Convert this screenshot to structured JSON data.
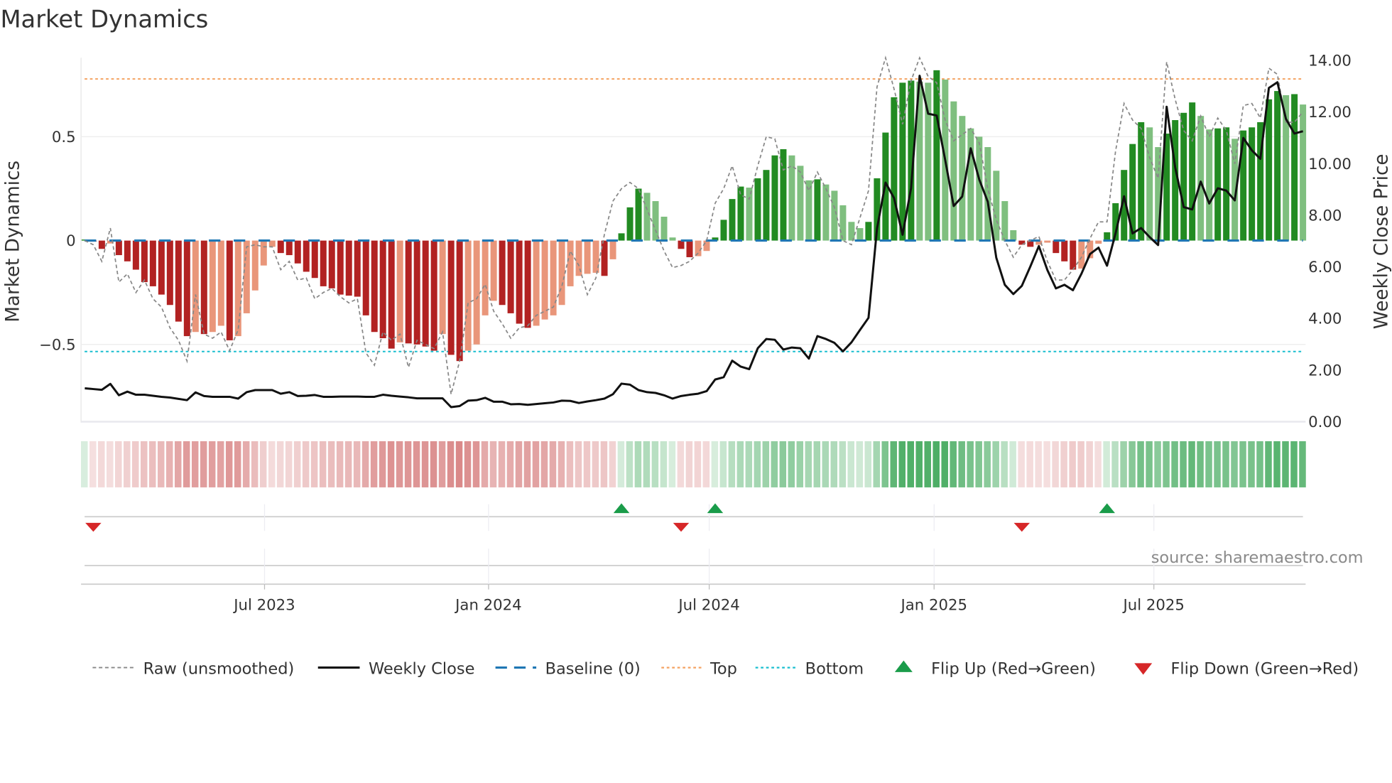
{
  "chart_data": {
    "type": "bar",
    "title": "Market Dynamics",
    "ylabel": "Market Dynamics",
    "y2label": "Weekly Close Price",
    "ylim": [
      -0.87,
      0.89
    ],
    "y2lim": [
      0,
      14.5
    ],
    "yticks": [
      {
        "v": 0.5,
        "label": "0.5"
      },
      {
        "v": 0,
        "label": "0"
      },
      {
        "v": -0.5,
        "label": "−0.5"
      }
    ],
    "y2ticks": [
      {
        "v": 0,
        "label": "0.00"
      },
      {
        "v": 2,
        "label": "2.00"
      },
      {
        "v": 4,
        "label": "4.00"
      },
      {
        "v": 6,
        "label": "6.00"
      },
      {
        "v": 8,
        "label": "8.00"
      },
      {
        "v": 10,
        "label": "10.00"
      },
      {
        "v": 12,
        "label": "12.00"
      },
      {
        "v": 14,
        "label": "14.00"
      }
    ],
    "xticks": [
      {
        "week_index": 21.1,
        "label": "Jul 2023"
      },
      {
        "week_index": 47.4,
        "label": "Jan 2024"
      },
      {
        "week_index": 73.3,
        "label": "Jul 2024"
      },
      {
        "week_index": 99.7,
        "label": "Jan 2025"
      },
      {
        "week_index": 125.5,
        "label": "Jul 2025"
      }
    ],
    "top": 0.778,
    "bottom": -0.534,
    "baseline": 0,
    "smoothed": [
      0.005,
      -0.005,
      -0.04,
      -0.014,
      -0.07,
      -0.1,
      -0.14,
      -0.2,
      -0.22,
      -0.26,
      -0.31,
      -0.39,
      -0.46,
      -0.44,
      -0.45,
      -0.44,
      -0.41,
      -0.48,
      -0.46,
      -0.35,
      -0.24,
      -0.12,
      -0.03,
      -0.06,
      -0.07,
      -0.11,
      -0.15,
      -0.18,
      -0.22,
      -0.23,
      -0.26,
      -0.265,
      -0.27,
      -0.36,
      -0.44,
      -0.47,
      -0.52,
      -0.49,
      -0.495,
      -0.5,
      -0.51,
      -0.53,
      -0.45,
      -0.55,
      -0.58,
      -0.53,
      -0.5,
      -0.36,
      -0.29,
      -0.31,
      -0.35,
      -0.4,
      -0.42,
      -0.41,
      -0.38,
      -0.36,
      -0.31,
      -0.22,
      -0.17,
      -0.16,
      -0.155,
      -0.17,
      -0.09,
      0.035,
      0.16,
      0.25,
      0.23,
      0.19,
      0.115,
      0.015,
      -0.04,
      -0.08,
      -0.075,
      -0.05,
      0.015,
      0.1,
      0.2,
      0.26,
      0.255,
      0.3,
      0.34,
      0.41,
      0.44,
      0.41,
      0.36,
      0.29,
      0.295,
      0.27,
      0.24,
      0.17,
      0.09,
      0.06,
      0.09,
      0.3,
      0.52,
      0.69,
      0.76,
      0.77,
      0.765,
      0.76,
      0.82,
      0.775,
      0.67,
      0.6,
      0.54,
      0.5,
      0.45,
      0.336,
      0.19,
      0.05,
      -0.02,
      -0.03,
      -0.02,
      -0.01,
      -0.06,
      -0.1,
      -0.14,
      -0.135,
      -0.085,
      -0.015,
      0.04,
      0.18,
      0.34,
      0.465,
      0.57,
      0.545,
      0.45,
      0.515,
      0.58,
      0.615,
      0.665,
      0.6,
      0.535,
      0.54,
      0.545,
      0.49,
      0.53,
      0.545,
      0.57,
      0.68,
      0.72,
      0.7,
      0.705,
      0.655
    ],
    "raw": [
      0.0,
      -0.02,
      -0.1,
      0.06,
      -0.2,
      -0.16,
      -0.25,
      -0.19,
      -0.28,
      -0.32,
      -0.42,
      -0.48,
      -0.58,
      -0.26,
      -0.45,
      -0.47,
      -0.44,
      -0.53,
      -0.43,
      -0.03,
      -0.02,
      -0.03,
      -0.03,
      -0.14,
      -0.1,
      -0.19,
      -0.18,
      -0.28,
      -0.25,
      -0.23,
      -0.27,
      -0.3,
      -0.28,
      -0.54,
      -0.6,
      -0.44,
      -0.48,
      -0.45,
      -0.61,
      -0.48,
      -0.5,
      -0.52,
      -0.44,
      -0.74,
      -0.58,
      -0.3,
      -0.28,
      -0.21,
      -0.34,
      -0.4,
      -0.47,
      -0.42,
      -0.41,
      -0.36,
      -0.34,
      -0.32,
      -0.22,
      -0.05,
      -0.12,
      -0.26,
      -0.18,
      0.03,
      0.19,
      0.25,
      0.28,
      0.25,
      0.15,
      0.05,
      -0.05,
      -0.13,
      -0.12,
      -0.1,
      -0.06,
      0.0,
      0.18,
      0.25,
      0.36,
      0.22,
      0.2,
      0.36,
      0.5,
      0.49,
      0.34,
      0.36,
      0.33,
      0.24,
      0.33,
      0.25,
      0.16,
      0.0,
      -0.02,
      0.11,
      0.24,
      0.74,
      0.88,
      0.73,
      0.56,
      0.77,
      0.88,
      0.79,
      0.76,
      0.58,
      0.48,
      0.51,
      0.54,
      0.47,
      0.25,
      0.1,
      0.0,
      -0.08,
      -0.02,
      0.0,
      0.02,
      -0.1,
      -0.19,
      -0.19,
      -0.14,
      -0.08,
      0.01,
      0.09,
      0.09,
      0.43,
      0.66,
      0.58,
      0.54,
      0.4,
      0.3,
      0.86,
      0.68,
      0.53,
      0.48,
      0.6,
      0.5,
      0.59,
      0.53,
      0.37,
      0.65,
      0.66,
      0.59,
      0.83,
      0.8,
      0.57,
      0.57,
      0.62
    ],
    "close": [
      1.26,
      1.23,
      1.2,
      1.43,
      0.99,
      1.13,
      1.01,
      1.01,
      0.97,
      0.93,
      0.9,
      0.85,
      0.8,
      1.1,
      0.96,
      0.93,
      0.93,
      0.93,
      0.86,
      1.11,
      1.19,
      1.19,
      1.19,
      1.05,
      1.11,
      0.96,
      0.97,
      1.0,
      0.93,
      0.93,
      0.94,
      0.94,
      0.94,
      0.93,
      0.93,
      1.01,
      0.97,
      0.94,
      0.91,
      0.87,
      0.87,
      0.87,
      0.87,
      0.53,
      0.57,
      0.78,
      0.8,
      0.89,
      0.74,
      0.74,
      0.64,
      0.65,
      0.62,
      0.65,
      0.68,
      0.71,
      0.78,
      0.77,
      0.69,
      0.75,
      0.8,
      0.86,
      1.03,
      1.44,
      1.4,
      1.19,
      1.11,
      1.08,
      0.99,
      0.86,
      0.96,
      1.01,
      1.05,
      1.15,
      1.6,
      1.69,
      2.33,
      2.1,
      2.0,
      2.81,
      3.17,
      3.14,
      2.76,
      2.84,
      2.81,
      2.41,
      3.28,
      3.17,
      3.02,
      2.69,
      3.04,
      3.52,
      3.99,
      7.45,
      9.23,
      8.63,
      7.21,
      9.02,
      13.37,
      11.9,
      11.83,
      10.11,
      8.32,
      8.69,
      10.56,
      9.35,
      8.49,
      6.32,
      5.27,
      4.91,
      5.23,
      5.98,
      6.77,
      5.84,
      5.13,
      5.27,
      5.06,
      5.7,
      6.46,
      6.71,
      6.01,
      7.26,
      8.7,
      7.26,
      7.47,
      7.12,
      6.81,
      12.17,
      9.82,
      8.28,
      8.19,
      9.27,
      8.42,
      9.01,
      8.92,
      8.54,
      10.96,
      10.48,
      10.15,
      12.9,
      13.12,
      11.7,
      11.13,
      11.22
    ],
    "flips_up": [
      63,
      74,
      120
    ],
    "flips_down": [
      1,
      70,
      110
    ],
    "legend_position": "bottom",
    "colors": {
      "up_strong": "#228b22",
      "up_weak": "#7fbf7f",
      "down_strong": "#b22222",
      "down_weak": "#e9967a",
      "raw": "#888888",
      "close": "#111111",
      "baseline": "#1f77b4",
      "top": "#f4a261",
      "bottom": "#17becf",
      "flip_up": "#1a9c4a",
      "flip_down": "#d62728"
    }
  },
  "source": "source: sharemaestro.com",
  "legend": [
    {
      "key": "raw",
      "label": "Raw (unsmoothed)"
    },
    {
      "key": "close",
      "label": "Weekly Close"
    },
    {
      "key": "baseline",
      "label": "Baseline (0)"
    },
    {
      "key": "top",
      "label": "Top"
    },
    {
      "key": "bottom",
      "label": "Bottom"
    },
    {
      "key": "flip_up",
      "label": "Flip Up (Red→Green)"
    },
    {
      "key": "flip_down",
      "label": "Flip Down (Green→Red)"
    }
  ]
}
